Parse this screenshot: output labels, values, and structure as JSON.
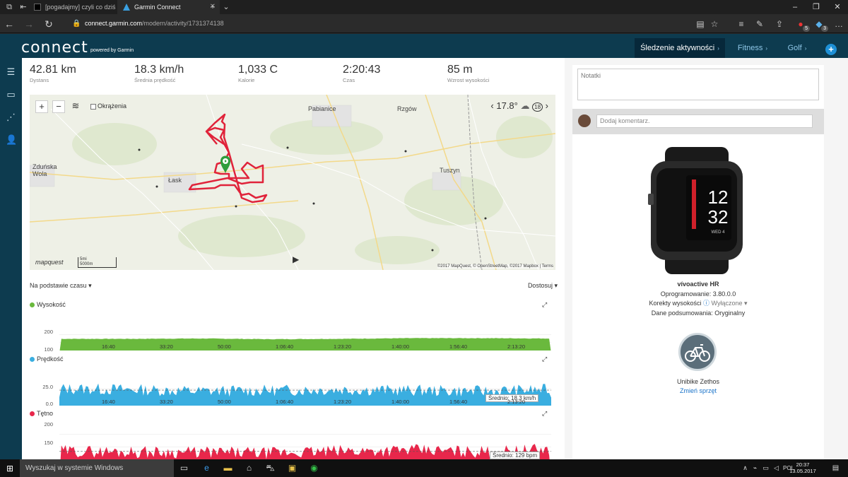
{
  "browser": {
    "tabs": [
      {
        "label": "[pogadajmy] czyli co dziś ro",
        "active": false
      },
      {
        "label": "Garmin Connect",
        "active": true
      }
    ],
    "url_domain": "connect.garmin.com",
    "url_path": "/modern/activity/1731374138",
    "badges": {
      "ext1": "5",
      "ext2": "3"
    }
  },
  "header": {
    "logo": "connect",
    "logo_sub": "powered by Garmin",
    "tabs": [
      {
        "label": "Śledzenie aktywności",
        "active": true
      },
      {
        "label": "Fitness",
        "active": false
      },
      {
        "label": "Golf",
        "active": false
      }
    ]
  },
  "stats": [
    {
      "value": "42.81 km",
      "label": "Dystans"
    },
    {
      "value": "18.3 km/h",
      "label": "Średnia prędkość"
    },
    {
      "value": "1,033 C",
      "label": "Kalorie"
    },
    {
      "value": "2:20:43",
      "label": "Czas"
    },
    {
      "value": "85 m",
      "label": "Wzrost wysokości"
    }
  ],
  "map": {
    "laps_label": "Okrążenia",
    "temperature": "17.8°",
    "wind": "18",
    "logo": "mapquest",
    "scale_mi": "5mi",
    "scale_m": "5000m",
    "copyright": "©2017 MapQuest, © OpenStreetMap, ©2017 Mapbox | Terms",
    "towns": [
      {
        "name": "Pabianice",
        "size": "big"
      },
      {
        "name": "Rzgów",
        "size": "big"
      },
      {
        "name": "Zduńska Wola",
        "size": "big"
      },
      {
        "name": "Łask",
        "size": "big"
      },
      {
        "name": "Tuszyn",
        "size": "big"
      }
    ]
  },
  "controls": {
    "time_basis": "Na podstawie czasu",
    "adjust": "Dostosuj"
  },
  "charts": {
    "elevation": {
      "title": "Wysokość",
      "color": "#6ab93d",
      "yticks": [
        "200",
        "100"
      ]
    },
    "speed": {
      "title": "Prędkość",
      "color": "#3aaee0",
      "yticks": [
        "25.0",
        "0.0"
      ],
      "avg_label": "Średnio: 18.3 km/h"
    },
    "hr": {
      "title": "Tętno",
      "color": "#e8274b",
      "yticks": [
        "200",
        "150"
      ],
      "avg_label": "Średnio: 129 bpm"
    },
    "xticks": [
      "16:40",
      "33:20",
      "50:00",
      "1:06:40",
      "1:23:20",
      "1:40:00",
      "1:56:40",
      "2:13:20"
    ]
  },
  "chart_data": [
    {
      "type": "area",
      "title": "Wysokość",
      "x": [
        "16:40",
        "33:20",
        "50:00",
        "1:06:40",
        "1:23:20",
        "1:40:00",
        "1:56:40",
        "2:13:20"
      ],
      "series": [
        {
          "name": "Wysokość",
          "values": [
            168,
            168,
            170,
            166,
            168,
            172,
            172,
            170
          ]
        }
      ],
      "ylim": [
        100,
        240
      ],
      "grid": true
    },
    {
      "type": "area",
      "title": "Prędkość",
      "x": [
        "16:40",
        "33:20",
        "50:00",
        "1:06:40",
        "1:23:20",
        "1:40:00",
        "1:56:40",
        "2:13:20"
      ],
      "series": [
        {
          "name": "Prędkość",
          "values": [
            20,
            19,
            17,
            18,
            19,
            18,
            17,
            19
          ]
        }
      ],
      "ylim": [
        0,
        30
      ],
      "grid": true
    },
    {
      "type": "area",
      "title": "Tętno",
      "x": [
        "16:40",
        "33:20",
        "50:00",
        "1:06:40",
        "1:23:20",
        "1:40:00",
        "1:56:40",
        "2:13:20"
      ],
      "series": [
        {
          "name": "Tętno",
          "values": [
            130,
            128,
            127,
            125,
            130,
            132,
            128,
            134
          ]
        }
      ],
      "ylim": [
        110,
        200
      ],
      "grid": true
    }
  ],
  "right": {
    "notes_placeholder": "Notatki",
    "comment_placeholder": "Dodaj komentarz.",
    "device_name": "vívoactive HR",
    "firmware": "Oprogramowanie: 3.80.0.0",
    "elev_corr_label": "Korekty wysokości",
    "elev_corr_value": "Wyłączone",
    "summary_data": "Dane podsumowania: Oryginalny",
    "watch_time_h": "12",
    "watch_time_m": "32",
    "watch_date": "WED 4",
    "gear_name": "Unibike Zethos",
    "gear_change": "Zmień sprzęt"
  },
  "taskbar": {
    "search": "Wyszukaj w systemie Windows",
    "lang": "POL",
    "time": "20:37",
    "date": "13.05.2017"
  },
  "colors": {
    "header": "#0d3b4f",
    "accent": "#1e90d6",
    "route": "#e0233a"
  }
}
